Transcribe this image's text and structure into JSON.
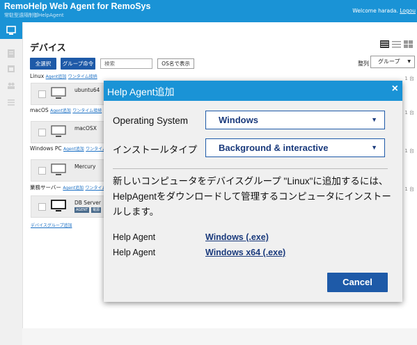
{
  "header": {
    "brand_r": "R",
    "brand_rest": "emoHelp Web Agent for RemoSys",
    "subtitle": "常駐型遠隔制御HelpAgent",
    "welcome": "Welcome harada.",
    "logout": "Logou"
  },
  "main": {
    "title": "デバイス",
    "select_all": "全選択",
    "group_cmd": "グループ命令",
    "search_placeholder": "検索",
    "os_name_btn": "OS名で表示",
    "sort_label": "整列",
    "sort_value": "グループ"
  },
  "groups": [
    {
      "name": "Linux",
      "link1": "Agent追加",
      "link2": "ワンタイム接続",
      "device": "ubuntu64",
      "count": "1 台"
    },
    {
      "name": "macOS",
      "link1": "Agent追加",
      "link2": "ワンタイム接続",
      "device": "macOSX",
      "count": "1 台"
    },
    {
      "name": "Windows PC",
      "link1": "Agent追加",
      "link2": "ワンタイム",
      "device": "Mercury",
      "count": "1 台"
    },
    {
      "name": "業務サーバー",
      "link1": "Agent追加",
      "link2": "ワンタイム",
      "device": "DB Server",
      "count": "1 台",
      "tag1": "AGENT",
      "tag2": "電源"
    }
  ],
  "add_group": "デバイスグループ追加",
  "modal": {
    "title": "Help Agent追加",
    "close": "×",
    "os_label": "Operating System",
    "os_value": "Windows",
    "install_label": "インストールタイプ",
    "install_value": "Background & interactive",
    "description": "新しいコンピュータをデバイスグループ \"Linux\"に追加するには、HelpAgentをダウンロードして管理するコンピュータにインストールします。",
    "downloads": [
      {
        "label": "Help Agent",
        "link": "Windows (.exe)"
      },
      {
        "label": "Help Agent",
        "link": "Windows x64 (.exe)"
      }
    ],
    "cancel": "Cancel"
  },
  "colors": {
    "accent": "#1a93d6",
    "button": "#1e5aa8"
  }
}
